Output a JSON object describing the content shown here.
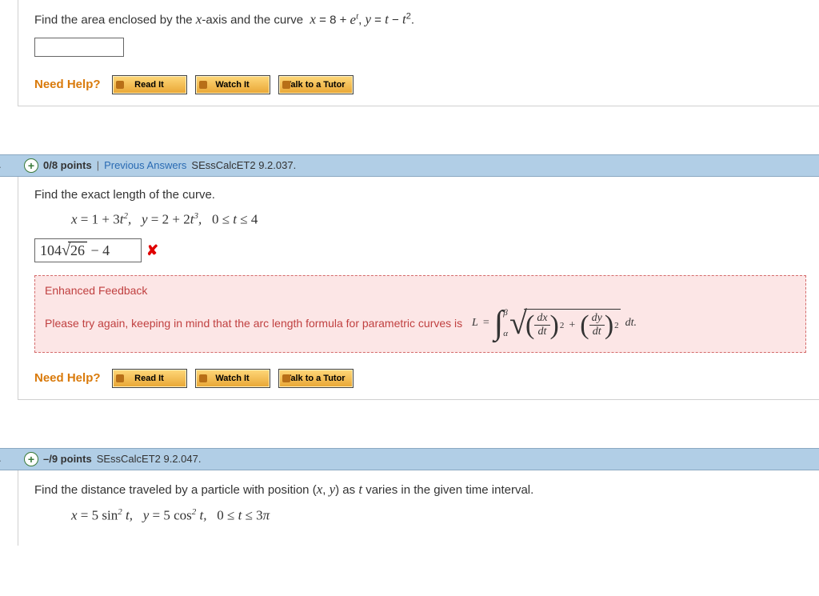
{
  "q1": {
    "prompt_html": "Find the area enclosed by the <span class='math-italic'>x</span>-axis and the curve&nbsp; <span class='math-italic'>x</span> = 8 + <span class='math-italic'>e<span class='sup'>t</span></span>, <span class='math-italic'>y</span> = <span class='math-italic'>t</span> − <span class='math-italic'>t</span><span class='sup'>2</span>."
  },
  "help": {
    "label": "Need Help?",
    "read": "Read It",
    "watch": "Watch It",
    "tutor": "Talk to a Tutor"
  },
  "q2": {
    "marker": ".",
    "points": "0/8 points",
    "prev": "Previous Answers",
    "ref": "SEssCalcET2 9.2.037.",
    "prompt": "Find the exact length of the curve.",
    "equation_html": "<span class='math-italic'>x</span> <span class='num'>= 1 + 3</span><span class='math-italic'>t</span><span class='sup'>2</span>,&nbsp;&nbsp;&nbsp;<span class='math-italic'>y</span> <span class='num'>= 2 + 2</span><span class='math-italic'>t</span><span class='sup'>3</span>,&nbsp;&nbsp;&nbsp;<span class='num'>0 ≤ </span><span class='math-italic'>t</span><span class='num'> ≤ 4</span>",
    "answer_html": "<span class='num'>104</span><span class='sqrt-sym'><span class='radical'>√</span><span class='vinculum num'>26</span></span>&nbsp;<span class='num'>− 4</span>",
    "feedback_title": "Enhanced Feedback",
    "feedback_lead": "Please try again, keeping in mind that the arc length formula for parametric curves is",
    "L": "L",
    "eq": "=",
    "alpha": "α",
    "beta": "β",
    "dx": "dx",
    "dy": "dy",
    "dt": "dt",
    "plus": "+",
    "dtend": "dt.",
    "two": "2"
  },
  "q3": {
    "marker": ".",
    "points": "–/9 points",
    "ref": "SEssCalcET2 9.2.047.",
    "prompt_html": "Find the distance traveled by a particle with position (<span class='math-italic'>x</span>, <span class='math-italic'>y</span>) as <span class='math-italic'>t</span> varies in the given time interval.",
    "equation_html": "<span class='math-italic'>x</span> <span class='num'>= 5 sin</span><span class='sup'>2</span> <span class='math-italic'>t</span>,&nbsp;&nbsp;&nbsp;<span class='math-italic'>y</span> <span class='num'>= 5 cos</span><span class='sup'>2</span> <span class='math-italic'>t</span>,&nbsp;&nbsp;&nbsp;<span class='num'>0 ≤ </span><span class='math-italic'>t</span><span class='num'> ≤ 3</span><span class='math-italic'>π</span>"
  }
}
